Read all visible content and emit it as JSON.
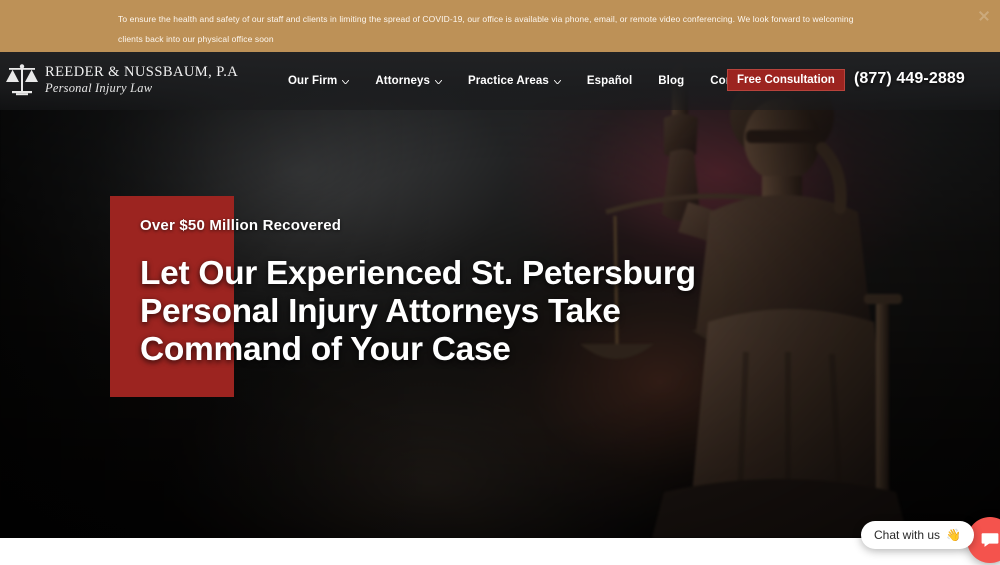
{
  "announcement": {
    "text": "To ensure the health and safety of our staff and clients in limiting the spread of COVID-19, our office is available via phone, email, or remote video conferencing. We look forward to welcoming clients back into our physical office soon",
    "close_icon": "close-icon",
    "background_color": "#bd9157"
  },
  "header": {
    "logo": {
      "icon": "scales-of-justice-icon",
      "name": "REEDER & NUSSBAUM, P.A",
      "tagline": "Personal Injury Law"
    },
    "nav": [
      {
        "label": "Our Firm",
        "has_dropdown": true
      },
      {
        "label": "Attorneys",
        "has_dropdown": true
      },
      {
        "label": "Practice Areas",
        "has_dropdown": true
      },
      {
        "label": "Español",
        "has_dropdown": false
      },
      {
        "label": "Blog",
        "has_dropdown": false
      },
      {
        "label": "Contact us",
        "has_dropdown": true
      }
    ],
    "cta_label": "Free Consultation",
    "cta_color": "#9c2420",
    "phone": "(877) 449-2889"
  },
  "hero": {
    "eyebrow": "Over $50 Million Recovered",
    "title": "Let Our Experienced St. Petersburg Personal Injury Attorneys Take Command of Your Case",
    "accent_color": "#9c2420",
    "background_image": "lady-justice-statue"
  },
  "chat_widget": {
    "label": "Chat with us",
    "emoji": "👋",
    "button_icon": "chat-bubble-icon",
    "button_color": "#f4534d"
  }
}
